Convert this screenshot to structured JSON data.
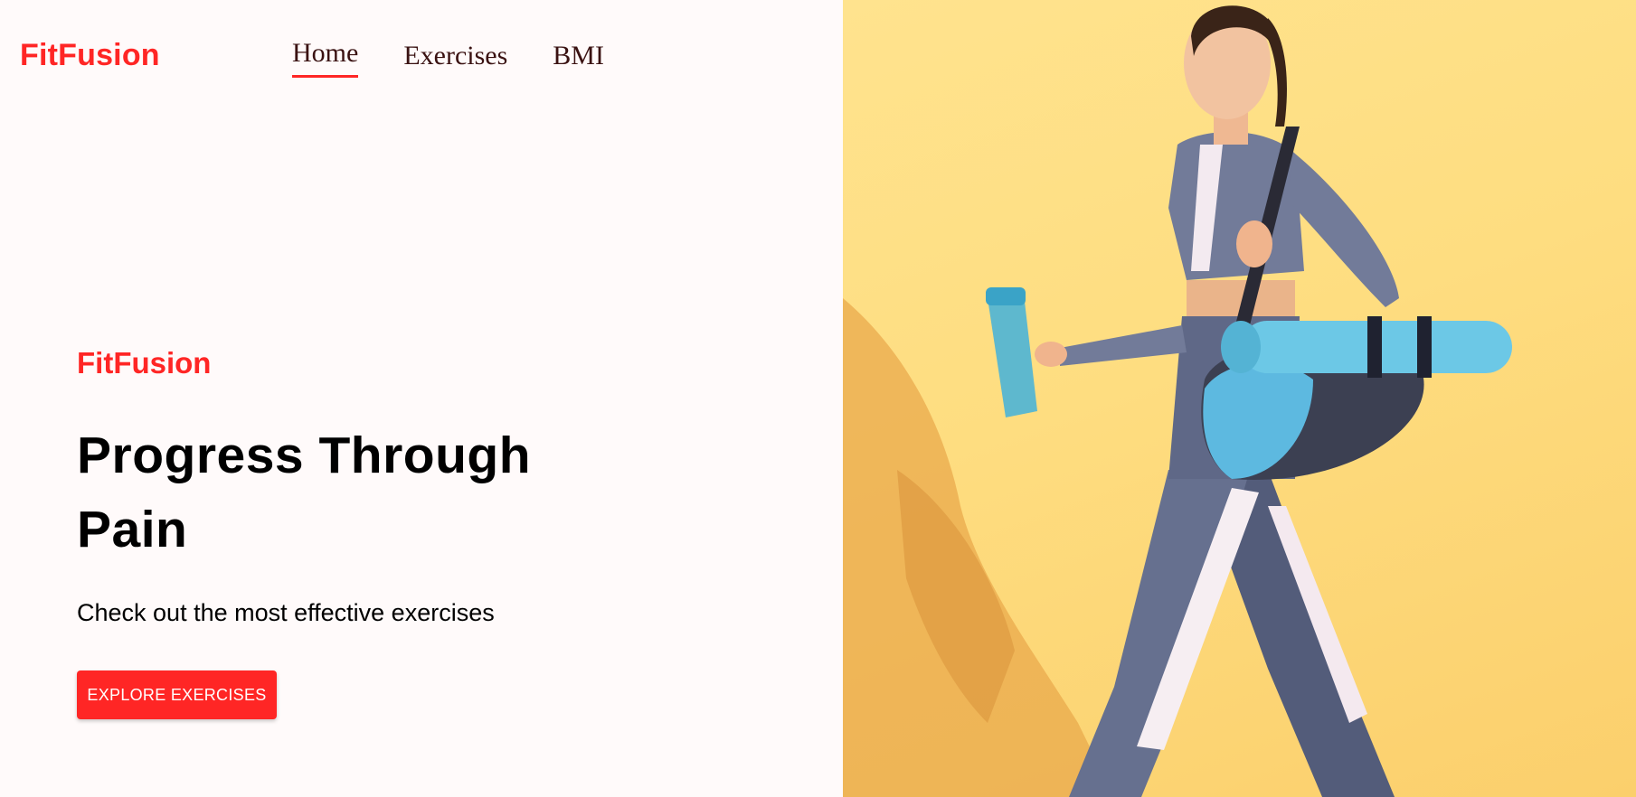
{
  "header": {
    "brand": "FitFusion",
    "nav": [
      {
        "label": "Home",
        "active": true
      },
      {
        "label": "Exercises",
        "active": false
      },
      {
        "label": "BMI",
        "active": false
      }
    ]
  },
  "hero": {
    "brand": "FitFusion",
    "title": "Progress Through Pain",
    "subtitle": "Check out the most effective exercises",
    "cta_label": "EXPLORE EXERCISES",
    "image_alt": "woman-walking-with-gym-bag-and-water-bottle"
  },
  "colors": {
    "accent": "#ff2625",
    "background": "#fffafa",
    "image_background": "#fedd80"
  }
}
